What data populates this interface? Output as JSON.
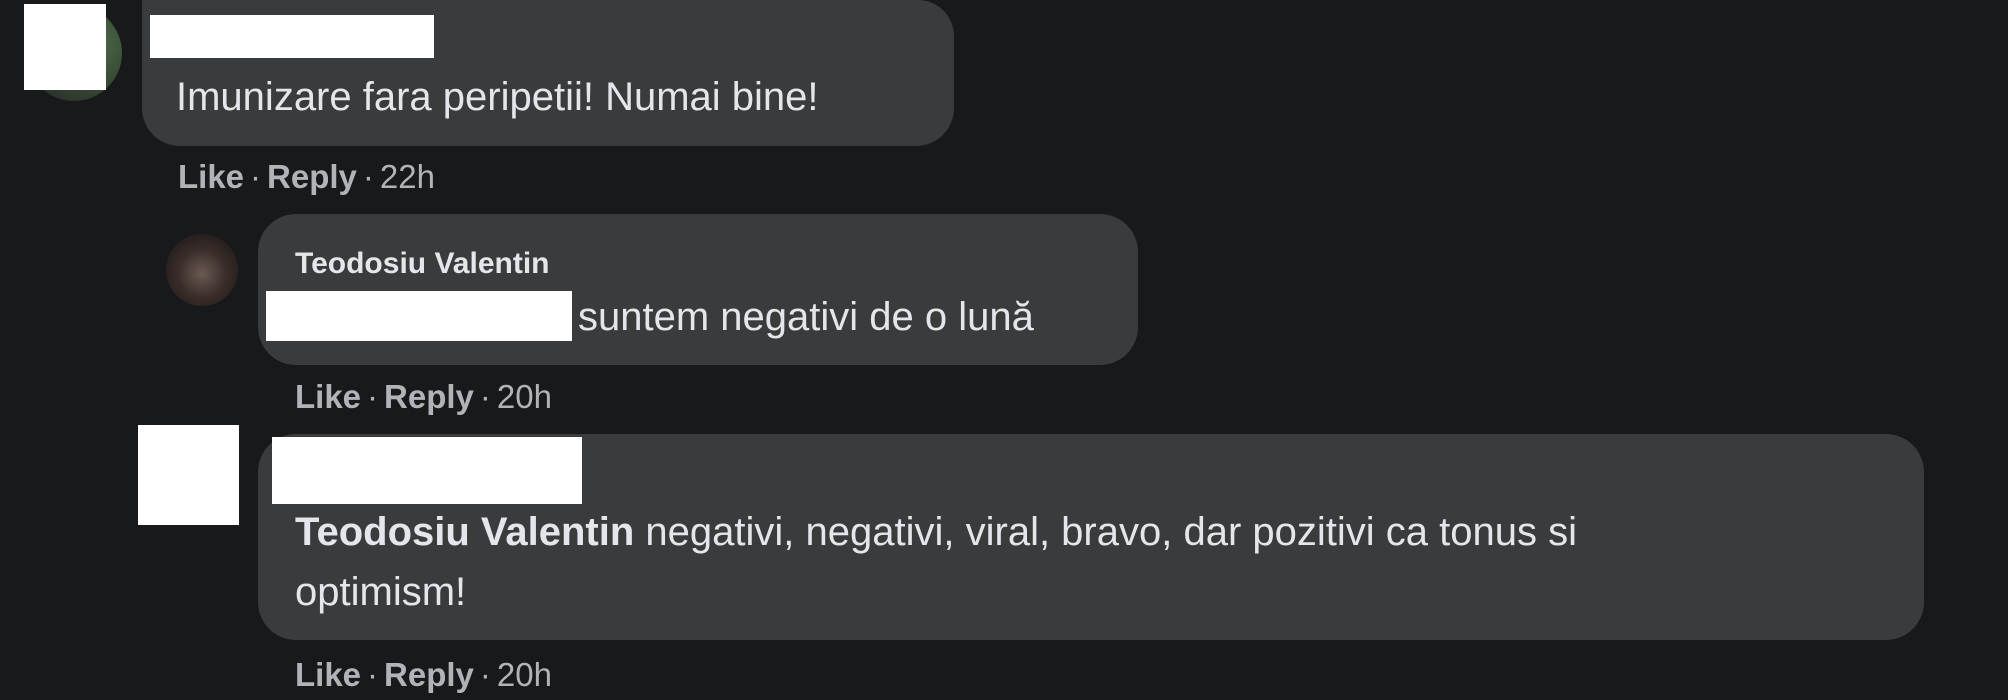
{
  "comments": [
    {
      "author": "",
      "text": "Imunizare fara peripetii! Numai bine!",
      "actions": {
        "like": "Like",
        "reply": "Reply",
        "time": "22h"
      }
    },
    {
      "author": "Teodosiu Valentin",
      "text": "suntem negativi de o lună",
      "actions": {
        "like": "Like",
        "reply": "Reply",
        "time": "20h"
      }
    },
    {
      "author": "",
      "mention": "Teodosiu Valentin",
      "text_line1": "negativi, negativi, viral, bravo, dar pozitivi ca tonus si",
      "text_line2": "optimism!",
      "actions": {
        "like": "Like",
        "reply": "Reply",
        "time": "20h"
      }
    }
  ],
  "separator": "·",
  "colors": {
    "background": "#18191a",
    "bubble": "#3a3b3c",
    "text": "#e4e6eb",
    "secondary_text": "#b0b3b8"
  }
}
